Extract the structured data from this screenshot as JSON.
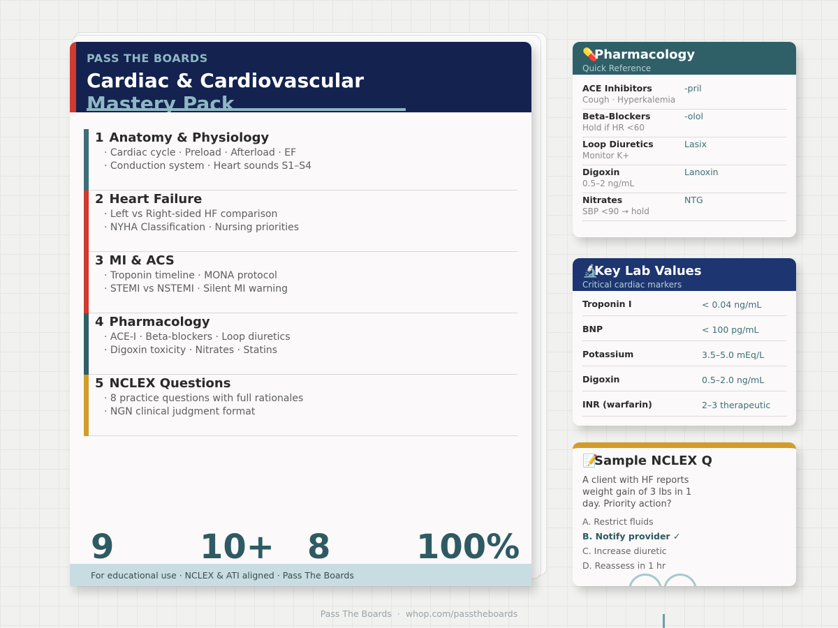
{
  "doc": {
    "brand": "PASS THE BOARDS",
    "title_line1": "Cardiac & Cardiovascular",
    "title_line2": "Mastery Pack",
    "sections": [
      {
        "num": "1",
        "title": "Anatomy & Physiology",
        "lines": [
          "· Cardiac cycle · Preload · Afterload · EF",
          "· Conduction system · Heart sounds S1–S4"
        ],
        "color": "#3d6f78"
      },
      {
        "num": "2",
        "title": "Heart Failure",
        "lines": [
          "· Left vs Right-sided HF comparison",
          "· NYHA Classification · Nursing priorities"
        ],
        "color": "#d03a2f"
      },
      {
        "num": "3",
        "title": "MI & ACS",
        "lines": [
          "· Troponin timeline · MONA protocol",
          "· STEMI vs NSTEMI · Silent MI warning"
        ],
        "color": "#d03a2f"
      },
      {
        "num": "4",
        "title": "Pharmacology",
        "lines": [
          "· ACE-I · Beta-blockers · Loop diuretics",
          "· Digoxin toxicity · Nitrates · Statins"
        ],
        "color": "#2f5f67"
      },
      {
        "num": "5",
        "title": "NCLEX Questions",
        "lines": [
          "· 8 practice questions with full rationales",
          "· NGN clinical judgment format"
        ],
        "color": "#d19d2a"
      }
    ],
    "stats": [
      "9",
      "10+",
      "8",
      "100%"
    ],
    "footer": "For educational use · NCLEX & ATI aligned · Pass The Boards"
  },
  "pharmacology": {
    "icon": "pill-icon",
    "glyph": "💊",
    "title": "Pharmacology",
    "subtitle": "Quick Reference",
    "rows": [
      {
        "drug": "ACE Inhibitors",
        "note": "Cough · Hyperkalemia",
        "tag": "-pril"
      },
      {
        "drug": "Beta-Blockers",
        "note": "Hold if HR <60",
        "tag": "-olol"
      },
      {
        "drug": "Loop Diuretics",
        "note": "Monitor K+",
        "tag": "Lasix"
      },
      {
        "drug": "Digoxin",
        "note": "0.5–2 ng/mL",
        "tag": "Lanoxin"
      },
      {
        "drug": "Nitrates",
        "note": "SBP <90 → hold",
        "tag": "NTG"
      }
    ]
  },
  "labs": {
    "icon": "lab-icon",
    "glyph": "🔬",
    "title": "Key Lab Values",
    "subtitle": "Critical cardiac markers",
    "rows": [
      {
        "name": "Troponin I",
        "value": "< 0.04 ng/mL"
      },
      {
        "name": "BNP",
        "value": "< 100 pg/mL"
      },
      {
        "name": "Potassium",
        "value": "3.5–5.0 mEq/L"
      },
      {
        "name": "Digoxin",
        "value": "0.5–2.0 ng/mL"
      },
      {
        "name": "INR (warfarin)",
        "value": "2–3 therapeutic"
      }
    ]
  },
  "nclex": {
    "icon": "question-icon",
    "glyph": "📝",
    "title": "Sample NCLEX Q",
    "question": "A client with HF reports weight gain of 3 lbs in 1 day. Priority action?",
    "options": [
      {
        "text": "A. Restrict fluids",
        "correct": false
      },
      {
        "text": "B. Notify provider ✓",
        "correct": true
      },
      {
        "text": "C. Increase diuretic",
        "correct": false
      },
      {
        "text": "D. Reassess in 1 hr",
        "correct": false
      }
    ]
  },
  "page_footer": {
    "brand": "Pass The Boards",
    "separator": "·",
    "url": "whop.com/passtheboards"
  },
  "colors": {
    "navy": "#13224f",
    "teal": "#2f5f67",
    "red": "#d03a2f",
    "gold": "#d19d2a",
    "lab_navy": "#1d3570"
  }
}
